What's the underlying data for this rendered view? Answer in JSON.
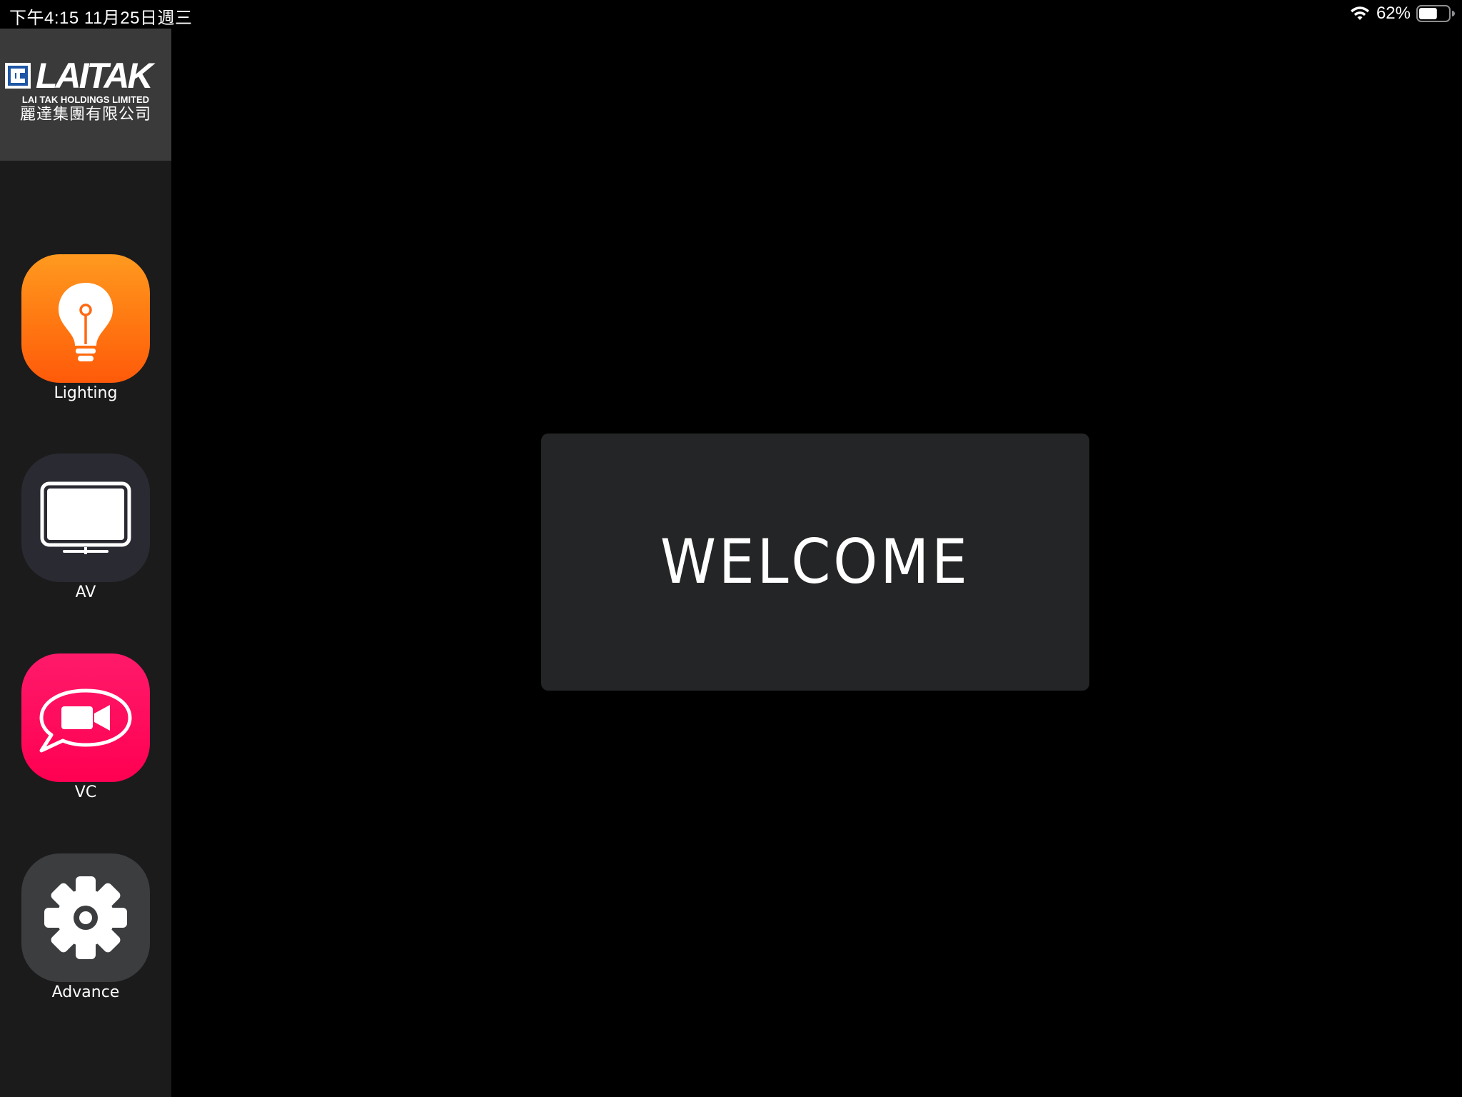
{
  "status_bar": {
    "time": "下午4:15   11月25日週三",
    "battery_percent_text": "62%",
    "battery_level": 0.62,
    "icons": [
      "wifi-icon",
      "battery-icon"
    ]
  },
  "logo": {
    "wordmark": "LAITAK",
    "english_name": "LAI TAK HOLDINGS LIMITED",
    "chinese_name": "麗達集團有限公司"
  },
  "sidebar": {
    "items": [
      {
        "label": "Lighting",
        "icon": "lightbulb-icon",
        "color": "#ff7a12"
      },
      {
        "label": "AV",
        "icon": "monitor-icon",
        "color": "#2a2a32"
      },
      {
        "label": "VC",
        "icon": "video-chat-icon",
        "color": "#ff0052"
      },
      {
        "label": "Advance",
        "icon": "gear-icon",
        "color": "#3b3d3f"
      }
    ]
  },
  "main": {
    "welcome_text": "WELCOME"
  },
  "colors": {
    "background": "#000000",
    "sidebar": "#1b1b1c",
    "logo_panel": "#3a3a3b",
    "welcome_panel": "#242527"
  }
}
